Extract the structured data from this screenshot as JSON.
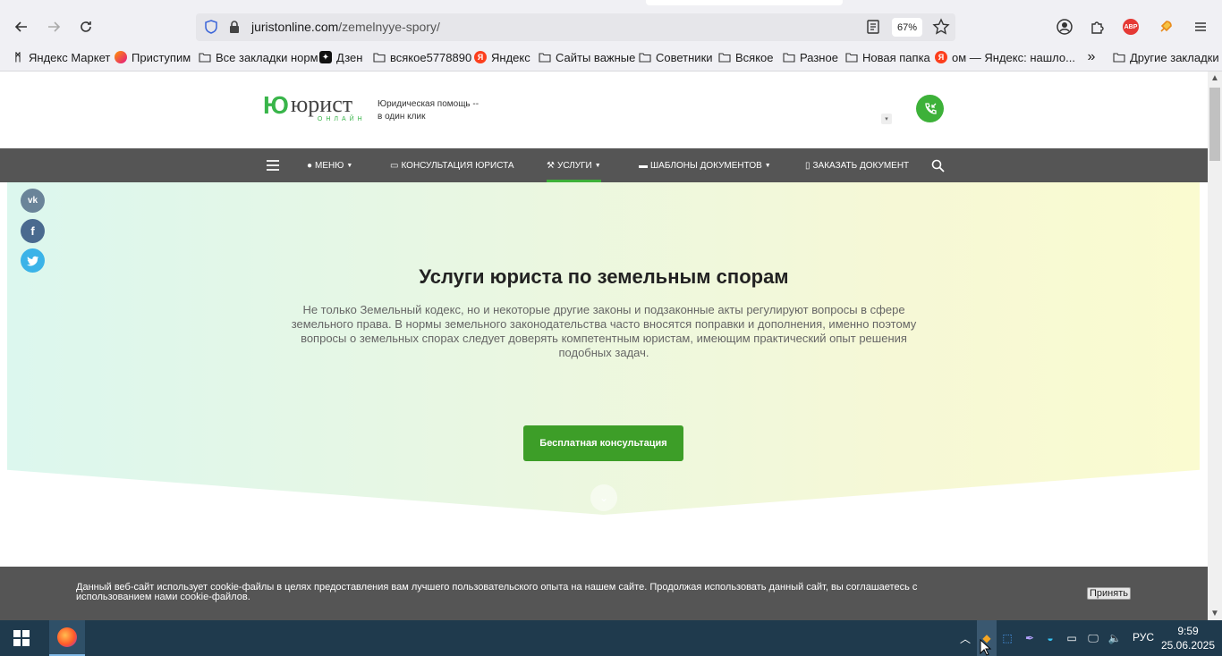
{
  "browser": {
    "url_domain": "juristonline.com",
    "url_path": "/zemelnyye-spory/",
    "zoom": "67%"
  },
  "bookmarks": [
    {
      "label": "Яндекс Маркет",
      "icon": "yandex-market-icon"
    },
    {
      "label": "Приступим",
      "icon": "firefox-icon"
    },
    {
      "label": "Все закладки норм",
      "icon": "folder-icon"
    },
    {
      "label": "Дзен",
      "icon": "dzen-icon"
    },
    {
      "label": "всякое5778890",
      "icon": "folder-icon"
    },
    {
      "label": "Яндекс",
      "icon": "yandex-icon"
    },
    {
      "label": "Сайты важные",
      "icon": "folder-icon"
    },
    {
      "label": "Советники",
      "icon": "folder-icon"
    },
    {
      "label": "Всякое",
      "icon": "folder-icon"
    },
    {
      "label": "Разное",
      "icon": "folder-icon"
    },
    {
      "label": "Новая папка",
      "icon": "folder-icon"
    },
    {
      "label": "ом — Яндекс: нашло...",
      "icon": "yandex-icon"
    },
    {
      "label": "Другие закладки",
      "icon": "folder-icon"
    }
  ],
  "site": {
    "logo_mark": "Ю",
    "logo_word": "юрист",
    "logo_sub": "ОНЛАЙН",
    "tagline_1": "Юридическая помощь --",
    "tagline_2": "в один клик",
    "nav": {
      "menu": "Меню",
      "consult": "Консультация юриста",
      "services": "Услуги",
      "templates": "Шаблоны документов",
      "order": "Заказать документ"
    },
    "hero": {
      "title": "Услуги юриста по земельным спорам",
      "text": "Не только Земельный кодекс, но и некоторые другие законы и подзаконные акты регулируют вопросы в сфере земельного права. В нормы земельного законодательства часто вносятся поправки и дополнения, именно поэтому вопросы о земельных спорах следует доверять компетентным юристам, имеющим практический опыт решения подобных задач.",
      "cta": "Бесплатная консультация"
    },
    "cookie": {
      "text": "Данный веб-сайт использует cookie-файлы в целях предоставления вам лучшего пользовательского опыта на нашем сайте. Продолжая использовать данный сайт, вы соглашаетесь с использованием нами cookie-файлов.",
      "accept": "Принять"
    }
  },
  "taskbar": {
    "lang": "РУС",
    "time": "9:59",
    "date": "25.06.2025"
  },
  "colors": {
    "brand_green": "#3db139",
    "nav_bg": "#555555",
    "vk": "#6a8499",
    "facebook": "#4a6a8f",
    "twitter": "#3bb3e8"
  }
}
